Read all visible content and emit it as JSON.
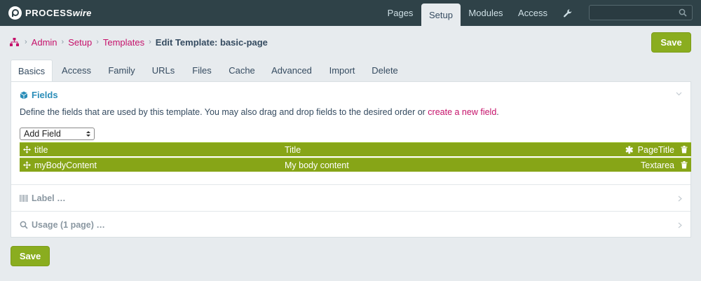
{
  "brand": {
    "logo_text_a": "PROCESS",
    "logo_text_b": "wire"
  },
  "topnav": {
    "pages": "Pages",
    "setup": "Setup",
    "modules": "Modules",
    "access": "Access",
    "search_placeholder": ""
  },
  "breadcrumb": {
    "items": [
      "Admin",
      "Setup",
      "Templates"
    ],
    "current": "Edit Template: basic-page"
  },
  "buttons": {
    "save_top": "Save",
    "save_bottom": "Save"
  },
  "tabs": [
    "Basics",
    "Access",
    "Family",
    "URLs",
    "Files",
    "Cache",
    "Advanced",
    "Import",
    "Delete"
  ],
  "fields_panel": {
    "title": "Fields",
    "description": "Define the fields that are used by this template. You may also drag and drop fields to the desired order or ",
    "link_text": "create a new field",
    "link_suffix": ".",
    "add_field_label": "Add Field",
    "rows": [
      {
        "name": "title",
        "label": "Title",
        "type": "PageTitle",
        "required": "✱"
      },
      {
        "name": "myBodyContent",
        "label": "My body content",
        "type": "Textarea",
        "required": ""
      }
    ]
  },
  "sections": {
    "label": "Label …",
    "usage": "Usage (1 page) …"
  },
  "colors": {
    "topbar": "#2f4248",
    "accent_green": "#8aad1f",
    "link": "#c5116a",
    "heading_blue": "#2a8db8"
  }
}
